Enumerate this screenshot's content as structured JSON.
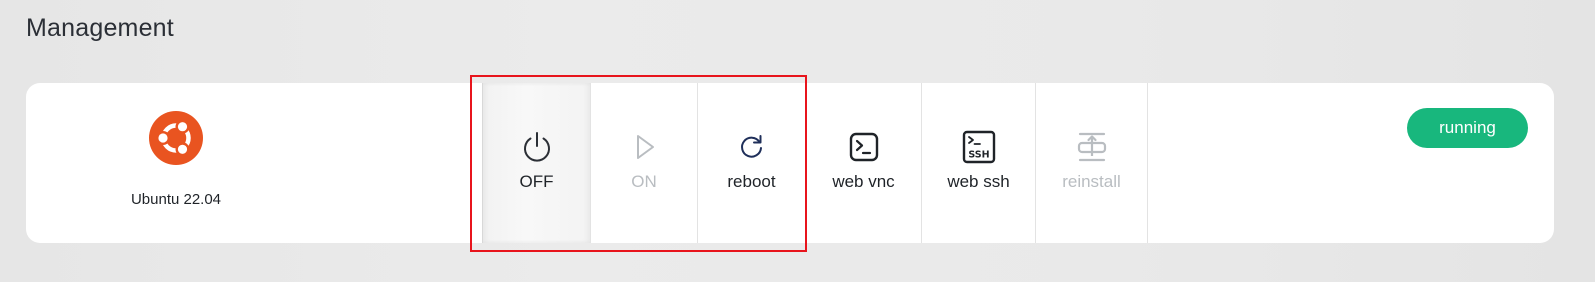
{
  "section": {
    "title": "Management"
  },
  "os": {
    "name": "Ubuntu 22.04",
    "icon": "ubuntu-logo",
    "brand_color": "#e95420"
  },
  "actions": [
    {
      "label": "OFF",
      "icon": "power-icon",
      "enabled": true,
      "active": true
    },
    {
      "label": "ON",
      "icon": "play-icon",
      "enabled": false
    },
    {
      "label": "reboot",
      "icon": "refresh-icon",
      "enabled": true
    },
    {
      "label": "web vnc",
      "icon": "terminal-icon",
      "enabled": true
    },
    {
      "label": "web ssh",
      "icon": "ssh-icon",
      "enabled": true
    },
    {
      "label": "reinstall",
      "icon": "reinstall-icon",
      "enabled": false
    }
  ],
  "status": {
    "label": "running",
    "color": "#18b77d"
  },
  "highlight": {
    "color": "#e8141c"
  }
}
